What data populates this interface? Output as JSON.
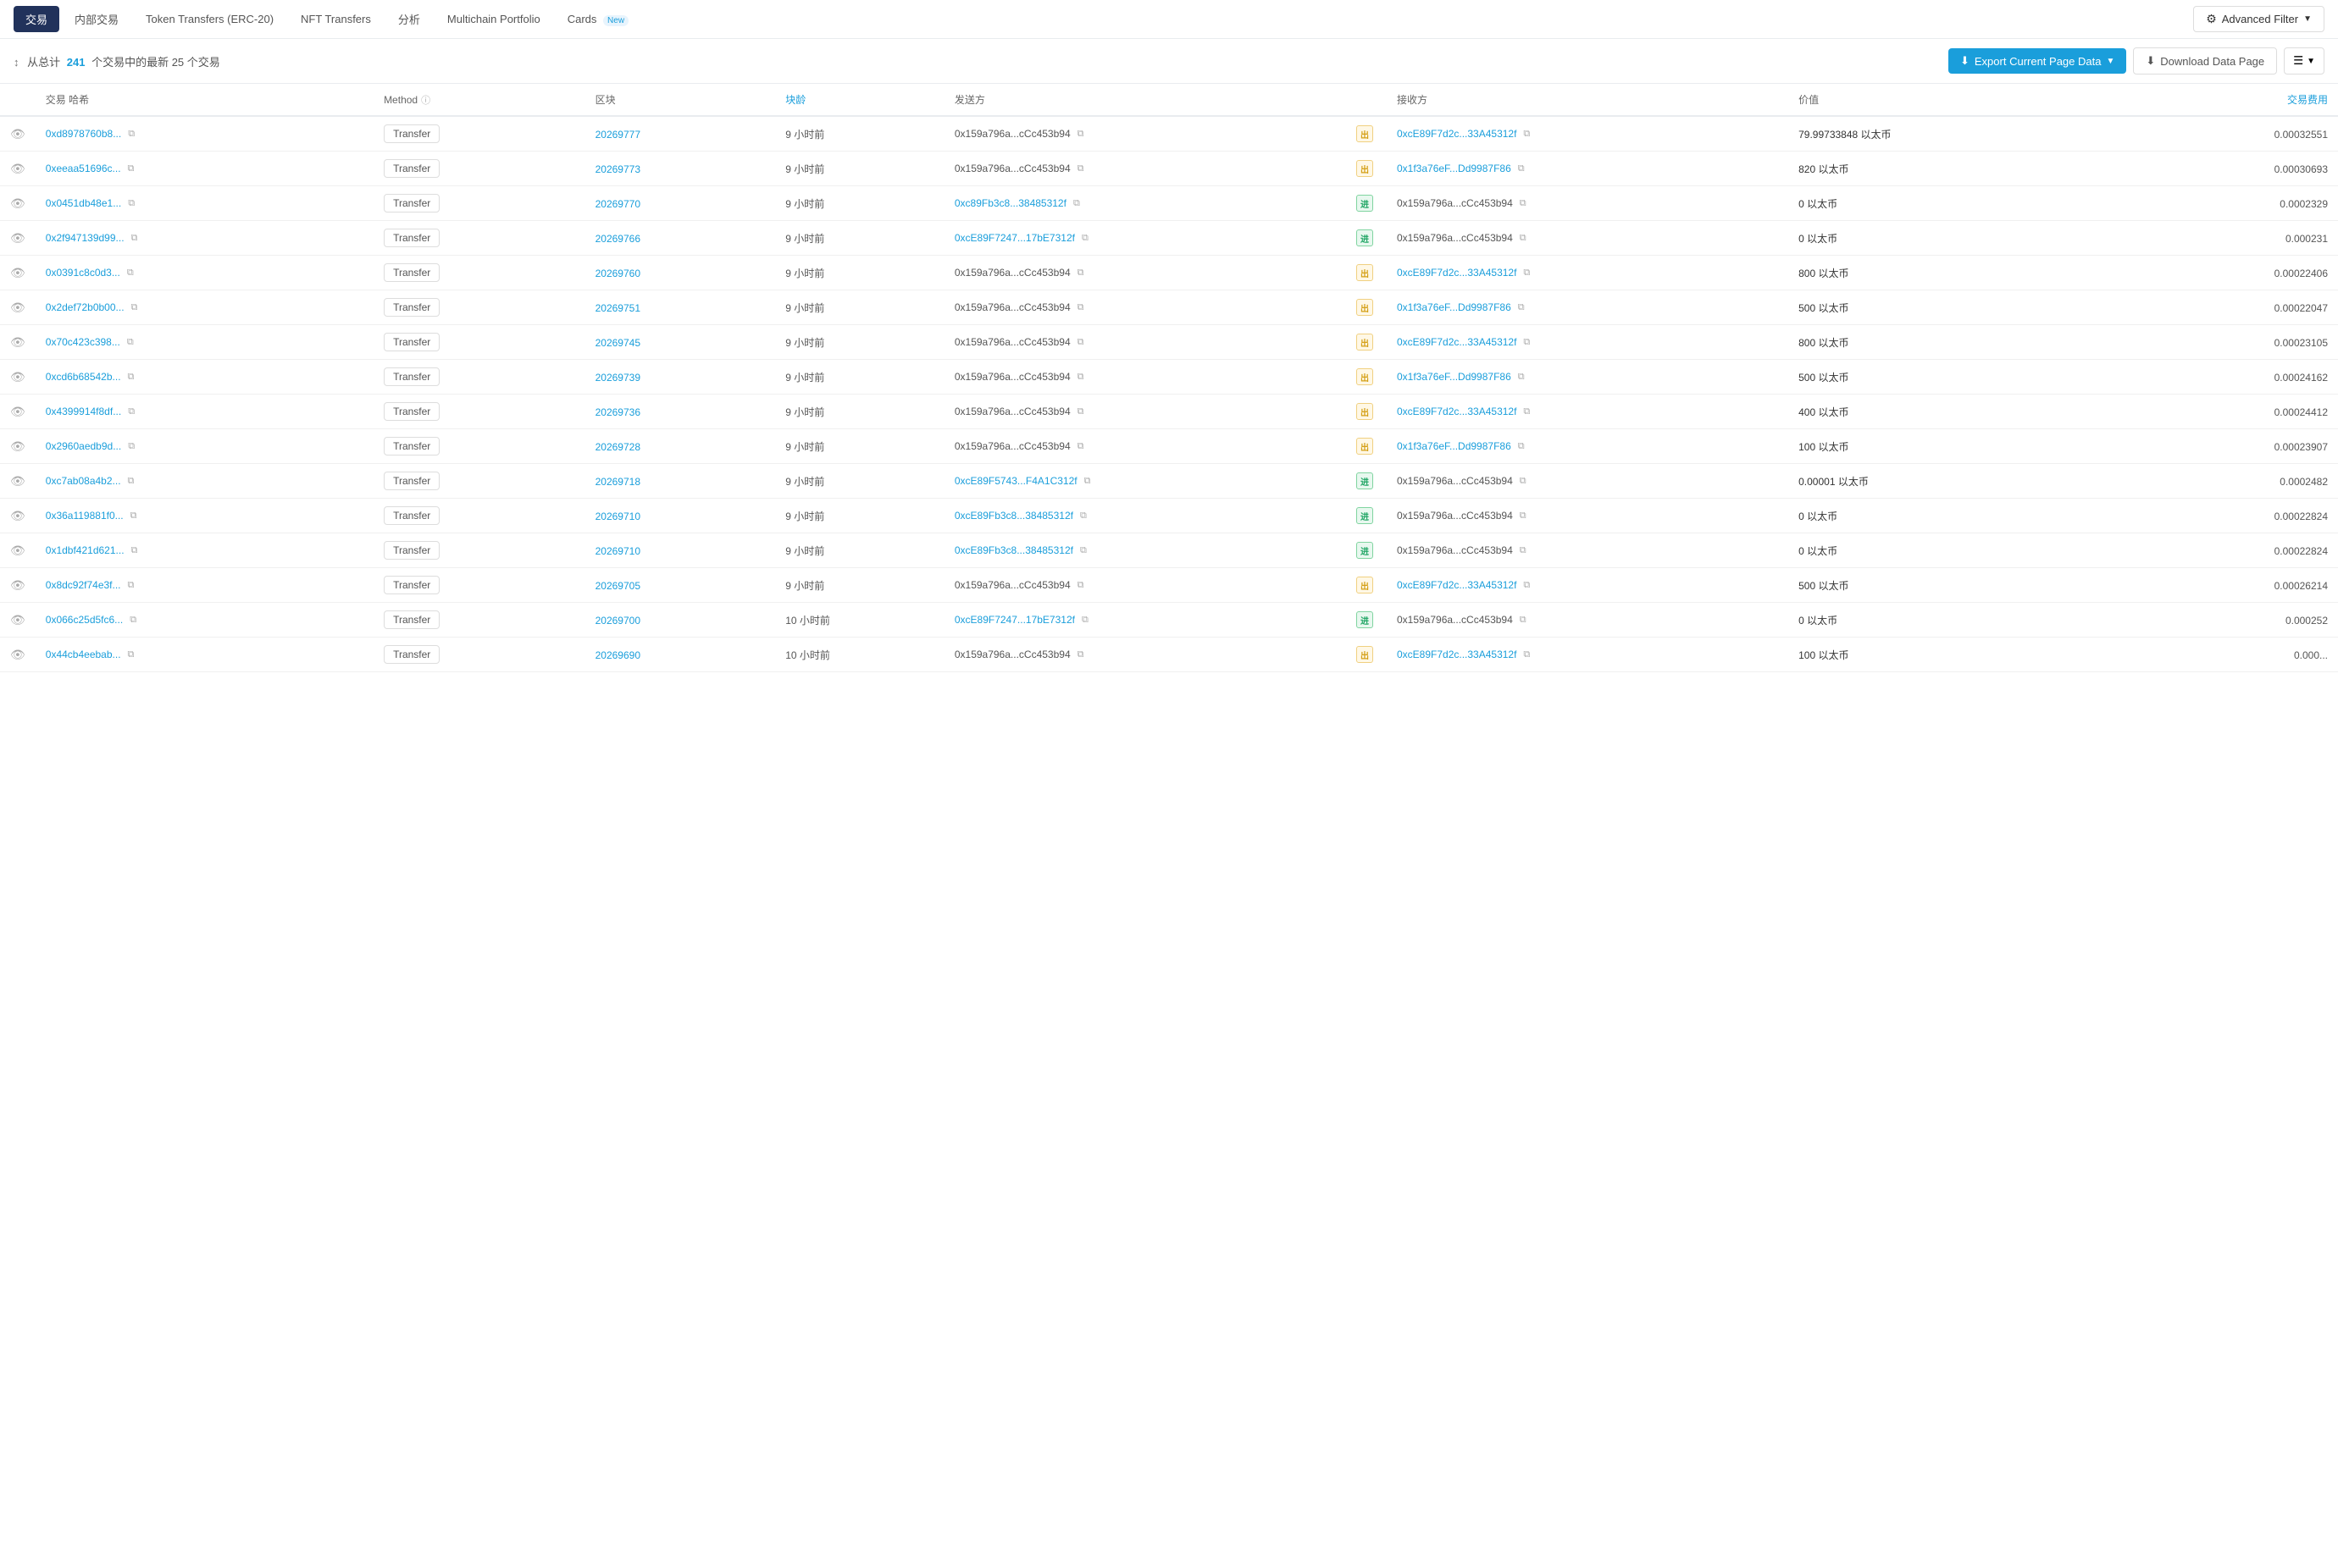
{
  "nav": {
    "tabs": [
      {
        "id": "transactions",
        "label": "交易",
        "active": true
      },
      {
        "id": "internal",
        "label": "内部交易",
        "active": false
      },
      {
        "id": "token-transfers",
        "label": "Token Transfers (ERC-20)",
        "active": false
      },
      {
        "id": "nft-transfers",
        "label": "NFT Transfers",
        "active": false
      },
      {
        "id": "analytics",
        "label": "分析",
        "active": false
      },
      {
        "id": "multichain",
        "label": "Multichain Portfolio",
        "active": false
      },
      {
        "id": "cards",
        "label": "Cards",
        "badge": "New",
        "active": false
      }
    ],
    "advanced_filter": "Advanced Filter"
  },
  "subheader": {
    "summary": "从总计",
    "total": "241",
    "summary2": "个交易中的最新 25 个交易",
    "export_label": "Export Current Page Data",
    "download_label": "Download Data Page"
  },
  "table": {
    "columns": [
      {
        "id": "eye",
        "label": ""
      },
      {
        "id": "hash",
        "label": "交易 哈希"
      },
      {
        "id": "method",
        "label": "Method",
        "info": true
      },
      {
        "id": "block",
        "label": "区块"
      },
      {
        "id": "age",
        "label": "块龄"
      },
      {
        "id": "from",
        "label": "发送方"
      },
      {
        "id": "dir",
        "label": ""
      },
      {
        "id": "to",
        "label": "接收方"
      },
      {
        "id": "value",
        "label": "价值"
      },
      {
        "id": "fee",
        "label": "交易费用",
        "highlight": true
      }
    ],
    "rows": [
      {
        "hash": "0xd8978760b8...",
        "method": "Transfer",
        "block": "20269777",
        "age": "9 小时前",
        "from": "0x159a796a...cCc453b94",
        "from_type": "plain",
        "direction": "out",
        "to": "0xcE89F7d2c...33A45312f",
        "to_type": "link",
        "value": "79.99733848 以太币",
        "fee": "0.00032551"
      },
      {
        "hash": "0xeeaa51696c...",
        "method": "Transfer",
        "block": "20269773",
        "age": "9 小时前",
        "from": "0x159a796a...cCc453b94",
        "from_type": "plain",
        "direction": "out",
        "to": "0x1f3a76eF...Dd9987F86",
        "to_type": "link",
        "value": "820 以太币",
        "fee": "0.00030693"
      },
      {
        "hash": "0x0451db48e1...",
        "method": "Transfer",
        "block": "20269770",
        "age": "9 小时前",
        "from": "0xc89Fb3c8...38485312f",
        "from_type": "link",
        "direction": "in",
        "to": "0x159a796a...cCc453b94",
        "to_type": "plain",
        "value": "0 以太币",
        "fee": "0.0002329"
      },
      {
        "hash": "0x2f947139d99...",
        "method": "Transfer",
        "block": "20269766",
        "age": "9 小时前",
        "from": "0xcE89F7247...17bE7312f",
        "from_type": "link",
        "direction": "in",
        "to": "0x159a796a...cCc453b94",
        "to_type": "plain",
        "value": "0 以太币",
        "fee": "0.000231"
      },
      {
        "hash": "0x0391c8c0d3...",
        "method": "Transfer",
        "block": "20269760",
        "age": "9 小时前",
        "from": "0x159a796a...cCc453b94",
        "from_type": "plain",
        "direction": "out",
        "to": "0xcE89F7d2c...33A45312f",
        "to_type": "link",
        "value": "800 以太币",
        "fee": "0.00022406"
      },
      {
        "hash": "0x2def72b0b00...",
        "method": "Transfer",
        "block": "20269751",
        "age": "9 小时前",
        "from": "0x159a796a...cCc453b94",
        "from_type": "plain",
        "direction": "out",
        "to": "0x1f3a76eF...Dd9987F86",
        "to_type": "link",
        "value": "500 以太币",
        "fee": "0.00022047"
      },
      {
        "hash": "0x70c423c398...",
        "method": "Transfer",
        "block": "20269745",
        "age": "9 小时前",
        "from": "0x159a796a...cCc453b94",
        "from_type": "plain",
        "direction": "out",
        "to": "0xcE89F7d2c...33A45312f",
        "to_type": "link",
        "value": "800 以太币",
        "fee": "0.00023105"
      },
      {
        "hash": "0xcd6b68542b...",
        "method": "Transfer",
        "block": "20269739",
        "age": "9 小时前",
        "from": "0x159a796a...cCc453b94",
        "from_type": "plain",
        "direction": "out",
        "to": "0x1f3a76eF...Dd9987F86",
        "to_type": "link",
        "value": "500 以太币",
        "fee": "0.00024162"
      },
      {
        "hash": "0x4399914f8df...",
        "method": "Transfer",
        "block": "20269736",
        "age": "9 小时前",
        "from": "0x159a796a...cCc453b94",
        "from_type": "plain",
        "direction": "out",
        "to": "0xcE89F7d2c...33A45312f",
        "to_type": "link",
        "value": "400 以太币",
        "fee": "0.00024412"
      },
      {
        "hash": "0x2960aedb9d...",
        "method": "Transfer",
        "block": "20269728",
        "age": "9 小时前",
        "from": "0x159a796a...cCc453b94",
        "from_type": "plain",
        "direction": "out",
        "to": "0x1f3a76eF...Dd9987F86",
        "to_type": "link",
        "value": "100 以太币",
        "fee": "0.00023907"
      },
      {
        "hash": "0xc7ab08a4b2...",
        "method": "Transfer",
        "block": "20269718",
        "age": "9 小时前",
        "from": "0xcE89F5743...F4A1C312f",
        "from_type": "link",
        "direction": "in",
        "to": "0x159a796a...cCc453b94",
        "to_type": "plain",
        "value": "0.00001 以太币",
        "fee": "0.0002482"
      },
      {
        "hash": "0x36a119881f0...",
        "method": "Transfer",
        "block": "20269710",
        "age": "9 小时前",
        "from": "0xcE89Fb3c8...38485312f",
        "from_type": "link",
        "direction": "in",
        "to": "0x159a796a...cCc453b94",
        "to_type": "plain",
        "value": "0 以太币",
        "fee": "0.00022824"
      },
      {
        "hash": "0x1dbf421d621...",
        "method": "Transfer",
        "block": "20269710",
        "age": "9 小时前",
        "from": "0xcE89Fb3c8...38485312f",
        "from_type": "link",
        "direction": "in",
        "to": "0x159a796a...cCc453b94",
        "to_type": "plain",
        "value": "0 以太币",
        "fee": "0.00022824"
      },
      {
        "hash": "0x8dc92f74e3f...",
        "method": "Transfer",
        "block": "20269705",
        "age": "9 小时前",
        "from": "0x159a796a...cCc453b94",
        "from_type": "plain",
        "direction": "out",
        "to": "0xcE89F7d2c...33A45312f",
        "to_type": "link",
        "value": "500 以太币",
        "fee": "0.00026214"
      },
      {
        "hash": "0x066c25d5fc6...",
        "method": "Transfer",
        "block": "20269700",
        "age": "10 小时前",
        "from": "0xcE89F7247...17bE7312f",
        "from_type": "link",
        "direction": "in",
        "to": "0x159a796a...cCc453b94",
        "to_type": "plain",
        "value": "0 以太币",
        "fee": "0.000252"
      },
      {
        "hash": "0x44cb4eebab...",
        "method": "Transfer",
        "block": "20269690",
        "age": "10 小时前",
        "from": "0x159a796a...cCc453b94",
        "from_type": "plain",
        "direction": "out",
        "to": "0xcE89F7d2c...33A45312f",
        "to_type": "link",
        "value": "100 以太币",
        "fee": "0.000..."
      }
    ]
  }
}
